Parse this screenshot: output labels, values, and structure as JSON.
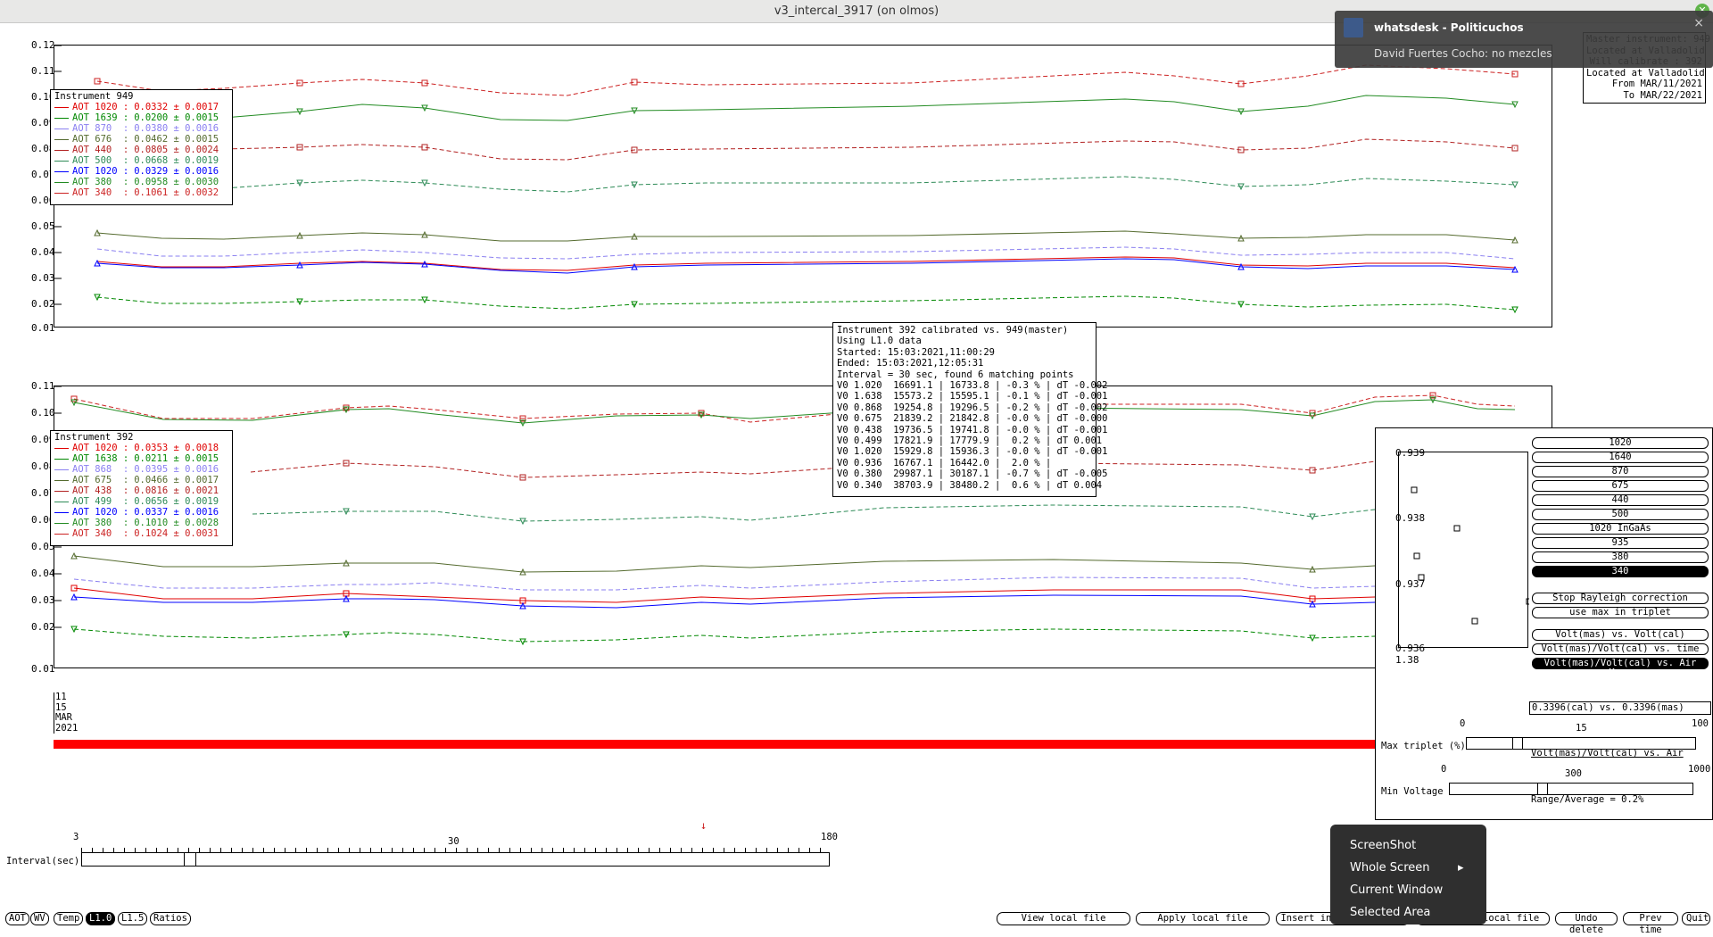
{
  "window": {
    "title": "v3_intercal_3917 (on olmos)"
  },
  "notification": {
    "app": "whatsdesk - Politicuchos",
    "message": "David Fuertes Cocho: no mezcles",
    "close": "×"
  },
  "master_info": {
    "lines": [
      "Master instrument: 949",
      "Located at Valladolid",
      "Will calibrate : 392",
      "Located at Valladolid",
      "From MAR/11/2021",
      "To MAR/22/2021"
    ]
  },
  "top_plot": {
    "y_ticks": [
      "0.12",
      "0.11",
      "0.10",
      "0.09",
      "0.08",
      "0.07",
      "0.06",
      "0.05",
      "0.04",
      "0.03",
      "0.02",
      "0.01"
    ],
    "legend": {
      "title": "Instrument 949",
      "entries": [
        {
          "label": "AOT 1020 :",
          "value": "0.0332 ± 0.0017",
          "color": "#e00000"
        },
        {
          "label": "AOT 1639 :",
          "value": "0.0200 ± 0.0015",
          "color": "#008800"
        },
        {
          "label": "AOT 870  :",
          "value": "0.0380 ± 0.0016",
          "color": "#8a7ff0"
        },
        {
          "label": "AOT 676  :",
          "value": "0.0462 ± 0.0015",
          "color": "#556b2f"
        },
        {
          "label": "AOT 440  :",
          "value": "0.0805 ± 0.0024",
          "color": "#b22222"
        },
        {
          "label": "AOT 500  :",
          "value": "0.0668 ± 0.0019",
          "color": "#2e8b57"
        },
        {
          "label": "AOT 1020 :",
          "value": "0.0329 ± 0.0016",
          "color": "#0000ff"
        },
        {
          "label": "AOT 380  :",
          "value": "0.0958 ± 0.0030",
          "color": "#228b22"
        },
        {
          "label": "AOT 340  :",
          "value": "0.1061 ± 0.0032",
          "color": "#cc2222"
        }
      ]
    }
  },
  "bottom_plot": {
    "y_ticks": [
      "0.11",
      "0.10",
      "0.09",
      "0.08",
      "0.07",
      "0.06",
      "0.05",
      "0.04",
      "0.03",
      "0.02",
      "0.01"
    ],
    "legend": {
      "title": "Instrument 392",
      "entries": [
        {
          "label": "AOT 1020 :",
          "value": "0.0353 ± 0.0018",
          "color": "#e00000"
        },
        {
          "label": "AOT 1638 :",
          "value": "0.0211 ± 0.0015",
          "color": "#008800"
        },
        {
          "label": "AOT 868  :",
          "value": "0.0395 ± 0.0016",
          "color": "#8a7ff0"
        },
        {
          "label": "AOT 675  :",
          "value": "0.0466 ± 0.0017",
          "color": "#556b2f"
        },
        {
          "label": "AOT 438  :",
          "value": "0.0816 ± 0.0021",
          "color": "#b22222"
        },
        {
          "label": "AOT 499  :",
          "value": "0.0656 ± 0.0019",
          "color": "#2e8b57"
        },
        {
          "label": "AOT 1020 :",
          "value": "0.0337 ± 0.0016",
          "color": "#0000ff"
        },
        {
          "label": "AOT 380  :",
          "value": "0.1010 ± 0.0028",
          "color": "#228b22"
        },
        {
          "label": "AOT 340  :",
          "value": "0.1024 ± 0.0031",
          "color": "#cc2222"
        }
      ]
    },
    "date_label": [
      "11",
      "15",
      "MAR",
      "2021"
    ]
  },
  "calibration_info": {
    "lines": [
      "Instrument 392 calibrated vs. 949(master)",
      "Using L1.0 data",
      "Started: 15:03:2021,11:00:29",
      "Ended: 15:03:2021,12:05:31",
      "Interval = 30 sec, found 6 matching points",
      "V0 1.020  16691.1 | 16733.8 | -0.3 % | dT -0.002",
      "V0 1.638  15573.2 | 15595.1 | -0.1 % | dT -0.001",
      "V0 0.868  19254.8 | 19296.5 | -0.2 % | dT -0.002",
      "V0 0.675  21839.2 | 21842.8 | -0.0 % | dT -0.000",
      "V0 0.438  19736.5 | 19741.8 | -0.0 % | dT -0.001",
      "V0 0.499  17821.9 | 17779.9 |  0.2 % | dT 0.001",
      "V0 1.020  15929.8 | 15936.3 | -0.0 % | dT -0.001",
      "V0 0.936  16767.1 | 16442.0 |  2.0 % |",
      "V0 0.380  29987.1 | 30187.1 | -0.7 % | dT -0.005",
      "V0 0.340  38703.9 | 38480.2 |  0.6 % | dT 0.004"
    ]
  },
  "right_panel": {
    "mini_y_ticks": [
      "0.939",
      "0.938",
      "0.937",
      "0.936"
    ],
    "mini_x_tick": "1.38",
    "wavelength_buttons": [
      "1020",
      "1640",
      "870",
      "675",
      "440",
      "500",
      "1020 InGaAs",
      "935",
      "380",
      "340"
    ],
    "active_wavelength": "340",
    "option_buttons": [
      "Stop Rayleigh correction",
      "use max in triplet"
    ],
    "mode_buttons": [
      "Volt(mas) vs. Volt(cal)",
      "Volt(mas)/Volt(cal) vs. time",
      "Volt(mas)/Volt(cal) vs. Air Mass"
    ],
    "active_mode": "Volt(mas)/Volt(cal) vs. Air Mass",
    "ratio_box": "0.3396(cal) vs. 0.3396(mas)",
    "mode_echo": "Volt(mas)/Volt(cal) vs. Air Mass",
    "range_text": "Range/Average = 0.2%",
    "max_triplet": {
      "label": "Max triplet (%)",
      "min": "0",
      "mid": "15",
      "max": "100",
      "value": 22
    },
    "min_voltage": {
      "label": "Min Voltage",
      "min": "0",
      "mid": "300",
      "max": "1000",
      "value": 380
    }
  },
  "interval_slider": {
    "label": "Interval(sec)",
    "min": "3",
    "mid": "30",
    "max": "180",
    "value": 30
  },
  "bottom_toggles": [
    "AOT",
    "WV",
    "Temp",
    "L1.0",
    "L1.5",
    "Ratios"
  ],
  "active_toggle": "L1.0",
  "bottom_buttons": [
    "View local file",
    "Apply local file",
    "Insert into local file",
    "Start new local file",
    "Undo delete",
    "Prev time",
    "Quit"
  ],
  "context_menu": {
    "items": [
      "ScreenShot",
      "Whole Screen",
      "Current Window",
      "Selected Area"
    ],
    "submenu_arrow": "▸"
  }
}
